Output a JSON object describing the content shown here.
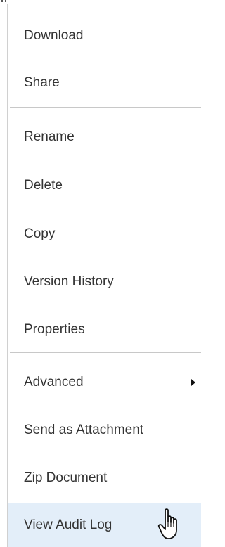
{
  "context_menu": {
    "groups": [
      {
        "items": [
          {
            "label": "Download",
            "icon": ""
          },
          {
            "label": "Share",
            "icon": ""
          }
        ]
      },
      {
        "items": [
          {
            "label": "Rename"
          },
          {
            "label": "Delete"
          },
          {
            "label": "Copy"
          },
          {
            "label": "Version History"
          },
          {
            "label": "Properties"
          }
        ]
      },
      {
        "items": [
          {
            "label": "Advanced",
            "has_submenu": true
          },
          {
            "label": "Send as Attachment"
          },
          {
            "label": "Zip Document"
          },
          {
            "label": "View Audit Log",
            "hovered": true
          }
        ]
      }
    ]
  },
  "cursor": {
    "icon": "hand-pointer-icon"
  },
  "colors": {
    "hover_background": "#e3eef9",
    "text": "#333333",
    "separator": "#c8c8c8"
  }
}
